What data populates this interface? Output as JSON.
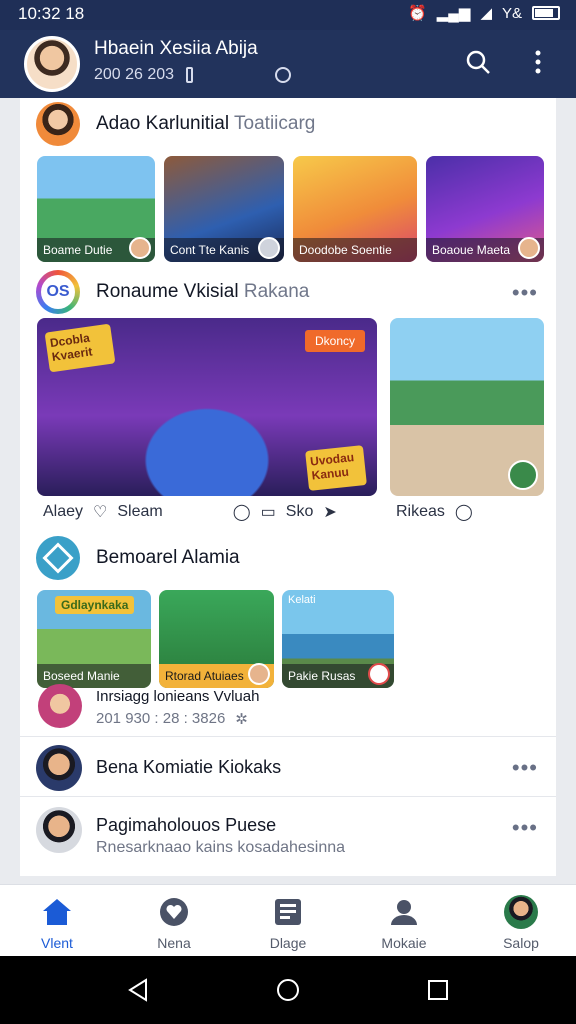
{
  "status": {
    "time": "10:32 18",
    "carrier": "Y&"
  },
  "header": {
    "name": "Hbaein Xesiia Abija",
    "meta": "200 26 203",
    "icons": [
      "search-icon",
      "more-vert-icon"
    ]
  },
  "section1": {
    "title": "Adao Karlunitial",
    "title_muted": "Toatiicarg",
    "thumbs": [
      {
        "caption": "Boame Dutie",
        "color": "#3aa36b"
      },
      {
        "caption": "Cont Tte Kanis",
        "color": "#2d5aa8"
      },
      {
        "caption": "Doodobe Soentie",
        "color": "#f0a93a"
      },
      {
        "caption": "Boaoue Maeta",
        "color": "#5c3aa6"
      }
    ]
  },
  "section2": {
    "avatar_text": "OS",
    "title": "Ronaume Vkisial",
    "title_muted": "Rakana",
    "more": "•••",
    "hero_badge": "Dkoncy",
    "hero_sticker_top": "Dcobla Kvaerit",
    "hero_sticker_bottom": "Uvodau Kanuu",
    "actions": {
      "user": "Alaey",
      "like": "Sleam",
      "share": "Sko"
    },
    "side_actions": {
      "user": "Rikeas"
    }
  },
  "section3": {
    "title": "Bemoarel Alamia",
    "thumbs": [
      {
        "caption": "Boseed Manie",
        "banner": "Gdlaynkaka"
      },
      {
        "caption": "Rtorad Atuiaes",
        "banner": ""
      },
      {
        "caption": "Pakie Rusas",
        "banner": "Kelati"
      }
    ],
    "sub_title": "Inrsiagg lonieans Vvluah",
    "sub_meta": "201 930 : 28 : 3826"
  },
  "rows": [
    {
      "title": "Bena Komiatie Kiokaks",
      "sub": ""
    },
    {
      "title": "Pagimaholouos Puese",
      "sub": "Rnesarknaao kains kosadahesinna"
    }
  ],
  "nav": [
    {
      "label": "Vlent",
      "icon": "home-icon",
      "active": true
    },
    {
      "label": "Nena",
      "icon": "heart-icon",
      "active": false
    },
    {
      "label": "Dlage",
      "icon": "news-icon",
      "active": false
    },
    {
      "label": "Mokaie",
      "icon": "profile-icon",
      "active": false
    },
    {
      "label": "Salop",
      "icon": "avatar-icon",
      "active": false
    }
  ]
}
